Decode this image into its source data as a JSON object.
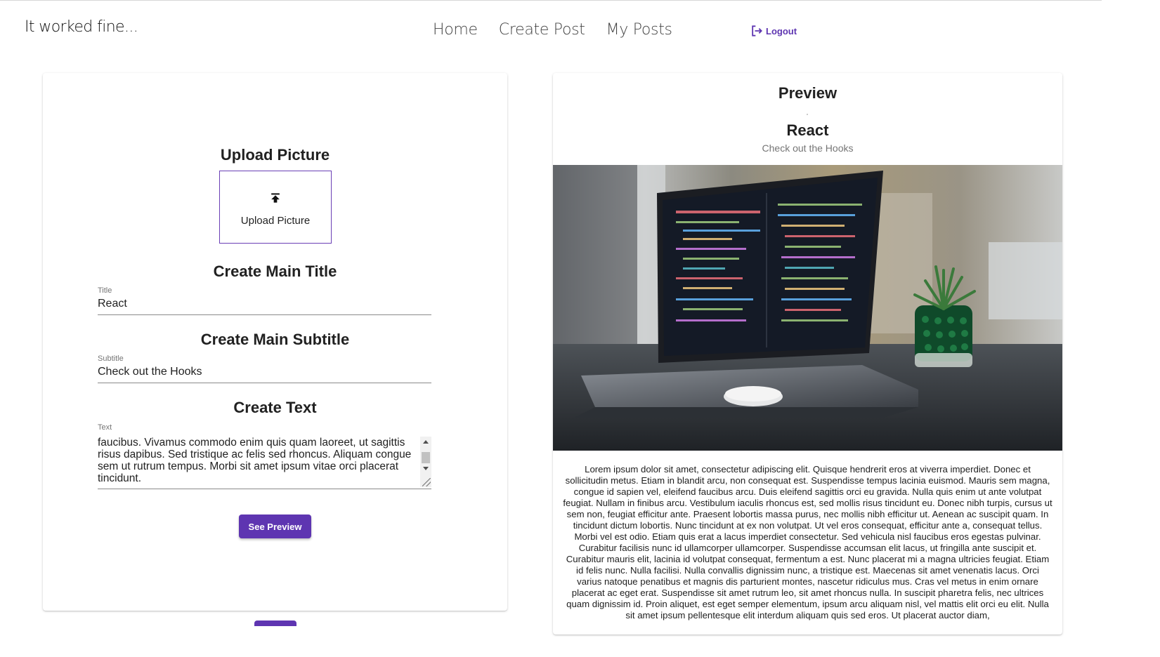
{
  "header": {
    "brand": "It worked fine...",
    "nav": [
      "Home",
      "Create Post",
      "My Posts"
    ],
    "logout_label": "Logout"
  },
  "editor": {
    "upload_heading": "Upload Picture",
    "upload_button_label": "Upload Picture",
    "title_heading": "Create Main Title",
    "title_label": "Title",
    "title_value": "React",
    "subtitle_heading": "Create Main Subtitle",
    "subtitle_label": "Subtitle",
    "subtitle_value": "Check out the Hooks",
    "text_heading": "Create Text",
    "text_label": "Text",
    "text_value": "faucibus. Vivamus commodo enim quis quam laoreet, ut sagittis risus dapibus. Sed tristique ac felis sed rhoncus. Aliquam congue sem ut rutrum tempus. Morbi sit amet ipsum vitae orci placerat tincidunt.",
    "preview_button": "See Preview"
  },
  "preview": {
    "heading": "Preview",
    "title": "React",
    "subtitle": "Check out the Hooks",
    "body": "Lorem ipsum dolor sit amet, consectetur adipiscing elit. Quisque hendrerit eros at viverra imperdiet. Donec et sollicitudin metus. Etiam in blandit arcu, non consequat est. Suspendisse tempus lacinia euismod. Mauris sem magna, congue id sapien vel, eleifend faucibus arcu. Duis eleifend sagittis orci eu gravida. Nulla quis enim ut ante volutpat feugiat. Nullam in finibus arcu. Vestibulum iaculis rhoncus est, sed mollis risus tincidunt eu. Donec nibh turpis, cursus ut sem non, feugiat efficitur ante. Praesent lobortis massa purus, nec mollis nibh efficitur ut. Aenean ac suscipit quam. In tincidunt dictum lobortis. Nunc tincidunt at ex non volutpat. Ut vel eros consequat, efficitur ante a, consequat tellus. Morbi vel est odio. Etiam quis erat a lacus imperdiet consectetur. Sed vehicula nisl faucibus eros egestas pulvinar. Curabitur facilisis nunc id ullamcorper ullamcorper. Suspendisse accumsan elit lacus, ut fringilla ante suscipit et. Curabitur mauris elit, lacinia id volutpat consequat, fermentum a est. Nunc placerat mi a magna ultricies feugiat. Etiam id felis nunc. Nulla facilisi. Nulla convallis dignissim nunc, a tristique est. Maecenas sit amet venenatis lacus. Orci varius natoque penatibus et magnis dis parturient montes, nascetur ridiculus mus. Cras vel metus in enim ornare placerat ac eget erat. Suspendisse sit amet rutrum leo, sit amet rhoncus nulla. In suscipit pharetra felis, nec ultrices quam dignissim id. Proin aliquet, est eget semper elementum, ipsum arcu aliquam nisl, vel mattis elit orci eu elit. Nulla sit amet ipsum pellentesque elit interdum aliquam quis sed eros. Ut placerat auctor diam,"
  },
  "icons": [
    "upload-icon",
    "logout-icon"
  ],
  "colors": {
    "accent": "#5e35b1",
    "text": "#212121",
    "muted": "#757575"
  }
}
